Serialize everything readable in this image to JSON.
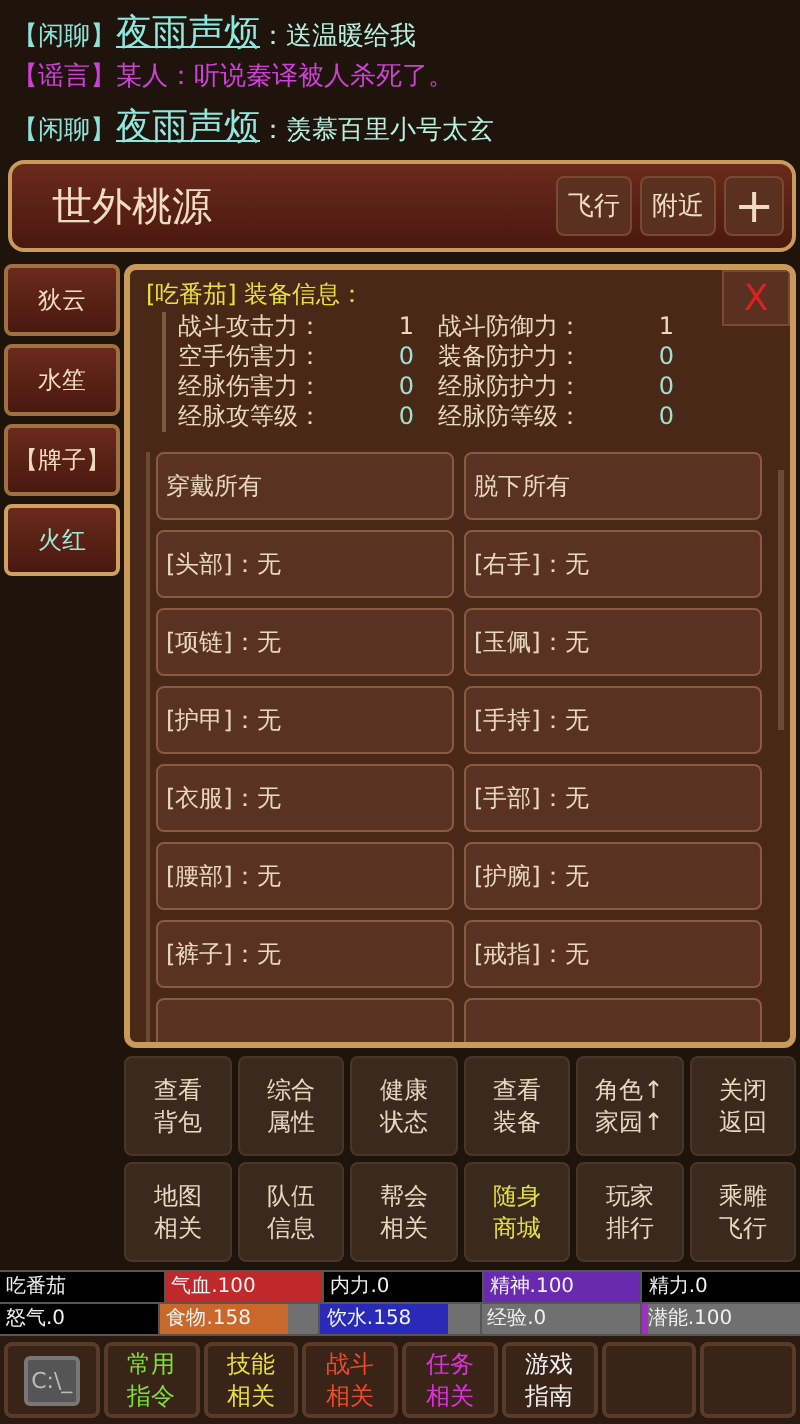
{
  "chat": [
    {
      "kind": "chat",
      "channel": "【闲聊】",
      "name": "夜雨声烦",
      "message": "：送温暖给我"
    },
    {
      "kind": "rumor",
      "channel": "【谣言】",
      "name": "某人",
      "message": "：听说秦译被人杀死了。"
    },
    {
      "kind": "chat",
      "channel": "【闲聊】",
      "name": "夜雨声烦",
      "message": "：羡慕百里小号太玄"
    }
  ],
  "location": {
    "title": "世外桃源",
    "buttons": [
      "飞行",
      "附近"
    ],
    "add": "+"
  },
  "sidebar": {
    "items": [
      {
        "label": "狄云",
        "selected": false
      },
      {
        "label": "水笙",
        "selected": false
      },
      {
        "label": "【牌子】",
        "selected": false
      },
      {
        "label": "火红",
        "selected": true
      }
    ]
  },
  "panel": {
    "heading": "[吃番茄] 装备信息：",
    "close": "X",
    "stats": [
      {
        "label": "战斗攻击力：",
        "value": "1"
      },
      {
        "label": "战斗防御力：",
        "value": "1"
      },
      {
        "label": "空手伤害力：",
        "value": "0"
      },
      {
        "label": "装备防护力：",
        "value": "0"
      },
      {
        "label": "经脉伤害力：",
        "value": "0"
      },
      {
        "label": "经脉防护力：",
        "value": "0"
      },
      {
        "label": "经脉攻等级：",
        "value": "0"
      },
      {
        "label": "经脉防等级：",
        "value": "0"
      }
    ],
    "slots": [
      "穿戴所有",
      "脱下所有",
      "[头部]：无",
      "[右手]：无",
      "[项链]：无",
      "[玉佩]：无",
      "[护甲]：无",
      "[手持]：无",
      "[衣服]：无",
      "[手部]：无",
      "[腰部]：无",
      "[护腕]：无",
      "[裤子]：无",
      "[戒指]：无"
    ]
  },
  "actions": [
    {
      "lines": [
        "查看",
        "背包"
      ],
      "highlight": false
    },
    {
      "lines": [
        "综合",
        "属性"
      ],
      "highlight": false
    },
    {
      "lines": [
        "健康",
        "状态"
      ],
      "highlight": false
    },
    {
      "lines": [
        "查看",
        "装备"
      ],
      "highlight": false
    },
    {
      "lines": [
        "角色↑",
        "家园↑"
      ],
      "highlight": false
    },
    {
      "lines": [
        "关闭",
        "返回"
      ],
      "highlight": false
    },
    {
      "lines": [
        "地图",
        "相关"
      ],
      "highlight": false
    },
    {
      "lines": [
        "队伍",
        "信息"
      ],
      "highlight": false
    },
    {
      "lines": [
        "帮会",
        "相关"
      ],
      "highlight": false
    },
    {
      "lines": [
        "随身",
        "商城"
      ],
      "highlight": true
    },
    {
      "lines": [
        "玩家",
        "排行"
      ],
      "highlight": false
    },
    {
      "lines": [
        "乘雕",
        "飞行"
      ],
      "highlight": false
    }
  ],
  "status": {
    "player": "吃番茄",
    "bars": [
      {
        "label": "气血.100",
        "level": 1,
        "color": "#c0282a"
      },
      {
        "label": "内力.0"
      },
      {
        "label": "精神.100",
        "level": 1,
        "color": "#6a2ab0"
      },
      {
        "label": "精力.0"
      },
      {
        "label": "怒气.0"
      },
      {
        "label": "食物.158",
        "level": 0.8,
        "color": "#c8682a"
      },
      {
        "label": "饮水.158",
        "level": 0.8,
        "color": "#2a2ab8"
      },
      {
        "label": "经验.0"
      },
      {
        "label": "潜能.100",
        "level": 0.04,
        "color": "#a030c0"
      }
    ]
  },
  "bottom_bar": [
    {
      "kind": "console",
      "label": "C:\\_"
    },
    {
      "kind": "text",
      "lines": [
        "常用",
        "指令"
      ],
      "color": "#7ee03a"
    },
    {
      "kind": "text",
      "lines": [
        "技能",
        "相关"
      ],
      "color": "#e8e040"
    },
    {
      "kind": "text",
      "lines": [
        "战斗",
        "相关"
      ],
      "color": "#f04a2a"
    },
    {
      "kind": "text",
      "lines": [
        "任务",
        "相关"
      ],
      "color": "#e030e0"
    },
    {
      "kind": "text",
      "lines": [
        "游戏",
        "指南"
      ],
      "color": "#f0f0f0"
    },
    {
      "kind": "empty"
    },
    {
      "kind": "empty"
    }
  ]
}
